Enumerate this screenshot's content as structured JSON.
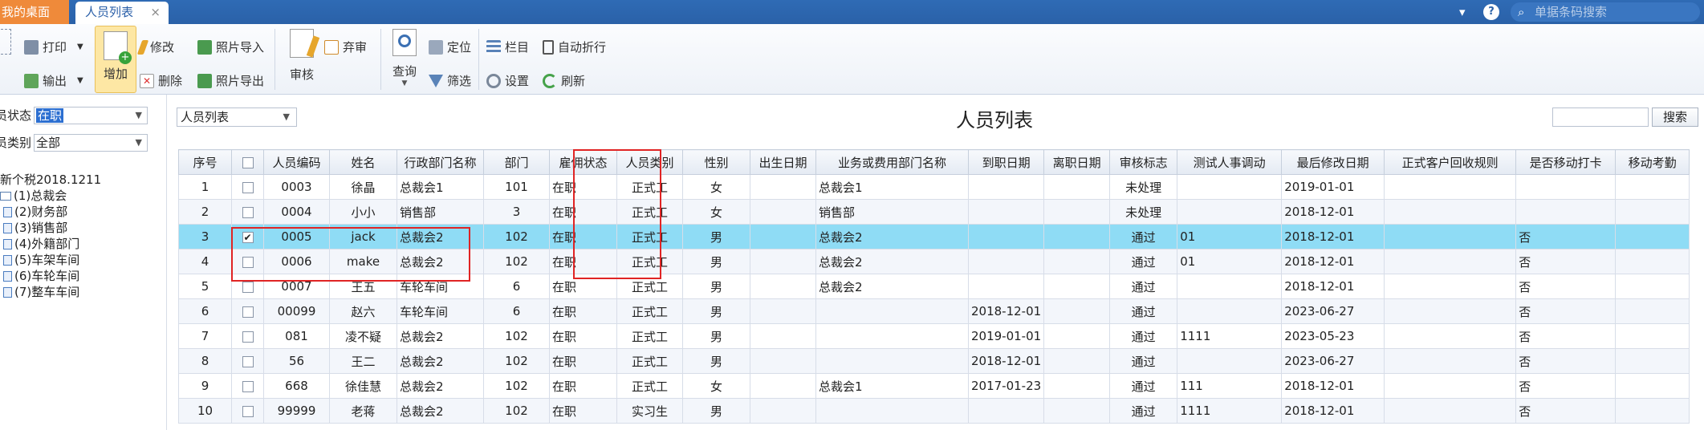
{
  "topbar": {
    "desk_tab": "我的桌面",
    "active_tab": "人员列表",
    "close": "×",
    "search_placeholder": "单据条码搜索"
  },
  "ribbon": {
    "print": "打印",
    "export": "输出",
    "add": "增加",
    "edit": "修改",
    "delete": "删除",
    "photo_import": "照片导入",
    "photo_export": "照片导出",
    "audit": "审核",
    "abandon": "弃审",
    "query": "查询",
    "locate": "定位",
    "filter": "筛选",
    "columns": "栏目",
    "autowrap": "自动折行",
    "settings": "设置",
    "refresh": "刷新"
  },
  "left": {
    "status_label": "员状态",
    "status_value": "在职",
    "category_label": "员类别",
    "category_value": "全部",
    "tree": [
      "新个税2018.1211",
      "(1)总裁会",
      "(2)财务部",
      "(3)销售部",
      "(4)外籍部门",
      "(5)车架车间",
      "(6)车轮车间",
      "(7)整车车间"
    ]
  },
  "main": {
    "list_select": "人员列表",
    "title": "人员列表",
    "search_button": "搜索"
  },
  "table": {
    "headers": [
      "序号",
      "",
      "人员编码",
      "姓名",
      "行政部门名称",
      "部门",
      "雇佣状态",
      "人员类别",
      "性别",
      "出生日期",
      "业务或费用部门名称",
      "到职日期",
      "离职日期",
      "审核标志",
      "测试人事调动",
      "最后修改日期",
      "正式客户回收规则",
      "是否移动打卡",
      "移动考勤"
    ],
    "rows": [
      [
        "1",
        "",
        "0003",
        "徐晶",
        "总裁会1",
        "101",
        "在职",
        "正式工",
        "女",
        "",
        "总裁会1",
        "",
        "",
        "未处理",
        "",
        "2019-01-01",
        "",
        "",
        ""
      ],
      [
        "2",
        "",
        "0004",
        "小小",
        "销售部",
        "3",
        "在职",
        "正式工",
        "女",
        "",
        "销售部",
        "",
        "",
        "未处理",
        "",
        "2018-12-01",
        "",
        "",
        ""
      ],
      [
        "3",
        "✔",
        "0005",
        "jack",
        "总裁会2",
        "102",
        "在职",
        "正式工",
        "男",
        "",
        "总裁会2",
        "",
        "",
        "通过",
        "01",
        "2018-12-01",
        "",
        "否",
        ""
      ],
      [
        "4",
        "",
        "0006",
        "make",
        "总裁会2",
        "102",
        "在职",
        "正式工",
        "男",
        "",
        "总裁会2",
        "",
        "",
        "通过",
        "01",
        "2018-12-01",
        "",
        "否",
        ""
      ],
      [
        "5",
        "",
        "0007",
        "王五",
        "车轮车间",
        "6",
        "在职",
        "正式工",
        "男",
        "",
        "总裁会2",
        "",
        "",
        "通过",
        "",
        "2018-12-01",
        "",
        "否",
        ""
      ],
      [
        "6",
        "",
        "00099",
        "赵六",
        "车轮车间",
        "6",
        "在职",
        "正式工",
        "男",
        "",
        "",
        "2018-12-01",
        "",
        "通过",
        "",
        "2023-06-27",
        "",
        "否",
        ""
      ],
      [
        "7",
        "",
        "081",
        "凌不疑",
        "总裁会2",
        "102",
        "在职",
        "正式工",
        "男",
        "",
        "",
        "2019-01-01",
        "",
        "通过",
        "1111",
        "2023-05-23",
        "",
        "否",
        ""
      ],
      [
        "8",
        "",
        "56",
        "王二",
        "总裁会2",
        "102",
        "在职",
        "正式工",
        "男",
        "",
        "",
        "2018-12-01",
        "",
        "通过",
        "",
        "2023-06-27",
        "",
        "否",
        ""
      ],
      [
        "9",
        "",
        "668",
        "徐佳慧",
        "总裁会2",
        "102",
        "在职",
        "正式工",
        "女",
        "",
        "总裁会1",
        "2017-01-23",
        "",
        "通过",
        "111",
        "2018-12-01",
        "",
        "否",
        ""
      ],
      [
        "10",
        "",
        "99999",
        "老蒋",
        "总裁会2",
        "102",
        "在职",
        "实习生",
        "男",
        "",
        "",
        "",
        "",
        "通过",
        "1111",
        "2018-12-01",
        "",
        "否",
        ""
      ]
    ]
  },
  "colors": {
    "topbar": "#2a61a8",
    "desk_tab": "#ef8a3a",
    "selected_row": "#8fdcf5",
    "highlight_box": "#e02424",
    "add_button": "#fde7a4"
  }
}
